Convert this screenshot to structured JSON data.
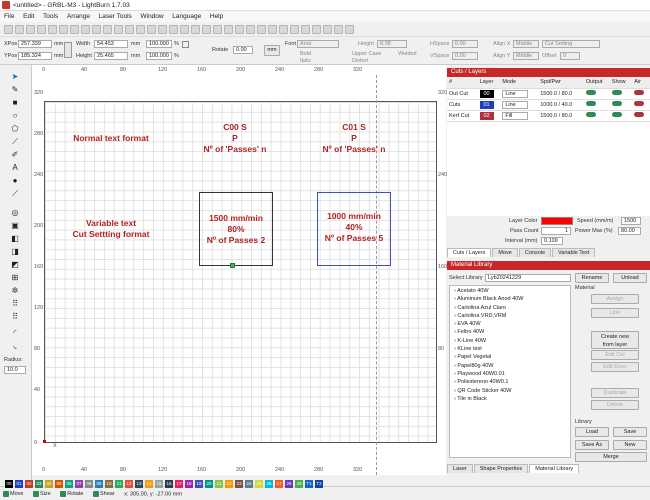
{
  "app": {
    "title": "<untitled> - GRBL-M3 - LightBurn 1.7.03"
  },
  "menu": [
    "File",
    "Edit",
    "Tools",
    "Arrange",
    "Laser Tools",
    "Window",
    "Language",
    "Help"
  ],
  "props": {
    "xpos_label": "XPos",
    "xpos": "257.339",
    "ypos_label": "YPos",
    "ypos": "185.324",
    "mm": "mm",
    "width_label": "Width",
    "width": "54.453",
    "height_label": "Height",
    "height": "25.465",
    "pct1": "100.000",
    "pct2": "100.000",
    "pct_sign": "%",
    "rotate_label": "Rotate",
    "rotate": "0.00",
    "mm_btn": "mm",
    "font_label": "Font",
    "font": "Arial",
    "height2_label": "Height",
    "height2": "8.38",
    "hspace_label": "HSpace",
    "hspace": "0.00",
    "vspace_label": "VSpace",
    "vspace": "0.00",
    "alignx_label": "Align X",
    "alignx": "Middle",
    "aligny_label": "Align Y",
    "aligny": "Middle",
    "offset_label": "Offset",
    "offset": "0",
    "bold": "Bold",
    "italic": "Italic",
    "upper": "Upper Case",
    "welded": "Welded",
    "distort": "Distort",
    "cut_setting": "Cut Setting"
  },
  "ruler": {
    "x_top": [
      "0",
      "40",
      "80",
      "120",
      "160",
      "200",
      "240",
      "280",
      "320"
    ],
    "y_left": [
      "320",
      "280",
      "240",
      "200",
      "160",
      "120",
      "80",
      "40",
      "0"
    ],
    "origin_x": "X"
  },
  "canvas": {
    "normal_text": "Normal text format",
    "variable_text_1": "Variable text",
    "variable_text_2": "Cut Settting format",
    "c00_1": "C00 S",
    "c00_2": "P",
    "c00_3": "Nº of 'Passes' n",
    "c01_1": "C01 S",
    "c01_2": "P",
    "c01_3": "Nº of 'Passes' n",
    "box1_1": "1500 mm/min",
    "box1_2": "80%",
    "box1_3": "Nº of Passes 2",
    "box2_1": "1000 mm/min",
    "box2_2": "40%",
    "box2_3": "Nº of Passes 5"
  },
  "left_tools": {
    "radius_label": "Radius:",
    "radius": "10.0"
  },
  "cuts": {
    "title": "Cuts / Layers",
    "headers": [
      "#",
      "Layer",
      "Mode",
      "Spd/Pwr",
      "Output",
      "Show",
      "Air"
    ],
    "rows": [
      {
        "name": "Out Cut",
        "layer": "00",
        "mode": "Line",
        "spdpwr": "1500.0 / 80.0",
        "color": "#000000"
      },
      {
        "name": "Cuts",
        "layer": "01",
        "mode": "Line",
        "spdpwr": "1000.0 / 40.0",
        "color": "#1f3fbf"
      },
      {
        "name": "Kerf Cut",
        "layer": "02",
        "mode": "Fill",
        "spdpwr": "1500.0 / 80.0",
        "color": "#b03040"
      }
    ],
    "layer_color_label": "Layer Color",
    "layer_color": "#ff0000",
    "speed_label": "Speed (mm/m)",
    "speed": "1500",
    "pass_count_label": "Pass Count",
    "pass_count": "1",
    "power_label": "Power Max (%)",
    "power": "80.00",
    "interval_label": "Interval (mm)",
    "interval": "0.100",
    "tabs": [
      "Cuts / Layers",
      "Move",
      "Console",
      "Variable Text"
    ]
  },
  "library": {
    "title": "Material Library",
    "select_label": "Select Library",
    "select": "Lyb20241229",
    "rename": "Rename",
    "unload": "Unload",
    "material_label": "Material",
    "assign": "Assign",
    "link": "Link",
    "create_new": "Create new",
    "from_layer": "from layer",
    "edit_cut": "Edit Cut",
    "edit_desc": "Edit Desc",
    "duplicate": "Duplicate",
    "delete": "Delete",
    "library_label": "Library",
    "load": "Load",
    "save": "Save",
    "save_as": "Save As",
    "new": "New",
    "merge": "Merge",
    "items": [
      "Acetato 40W",
      "Aluminum Black Anod 40W",
      "Cartolina Azul Claro",
      "Cartolina VRD,VRM",
      "EVA 40W",
      "Feltro 40W",
      "K-Line 40W",
      "KLine test",
      "Papel Vegetal",
      "Papel80g 40W",
      "Playwood 40W0.01",
      "Poliestereno 40W0.1",
      "QR Code Sticker 40W",
      "Tile in Black"
    ],
    "tabs": [
      "Laser",
      "Shape Properties",
      "Material Library"
    ]
  },
  "status": {
    "move": "Move",
    "size": "Size",
    "rotate": "Rotate",
    "shear": "Shear",
    "coords": "x: 305.00, y: -27.00 mm",
    "palette": [
      "00",
      "01",
      "02",
      "03",
      "04",
      "05",
      "06",
      "07",
      "08",
      "09",
      "10",
      "11",
      "12",
      "13",
      "14",
      "15",
      "16",
      "17",
      "18",
      "19",
      "20",
      "21",
      "22",
      "23",
      "24",
      "25",
      "26",
      "27",
      "28",
      "29",
      "T1",
      "T2"
    ],
    "palette_colors": [
      "#000000",
      "#1f3fbf",
      "#c0392b",
      "#2e8b57",
      "#c9a227",
      "#d35400",
      "#16a085",
      "#8e44ad",
      "#7f8c8d",
      "#2980b9",
      "#8e6c3a",
      "#27ae60",
      "#e74c3c",
      "#34495e",
      "#f39c12",
      "#95a5a6",
      "#2c3e50",
      "#e91e63",
      "#9c27b0",
      "#3f51b5",
      "#009688",
      "#8bc34a",
      "#ff9800",
      "#795548",
      "#607d8b",
      "#cddc39",
      "#00bcd4",
      "#ff5722",
      "#673ab7",
      "#4caf50",
      "#1565c0",
      "#0d47a1"
    ]
  }
}
